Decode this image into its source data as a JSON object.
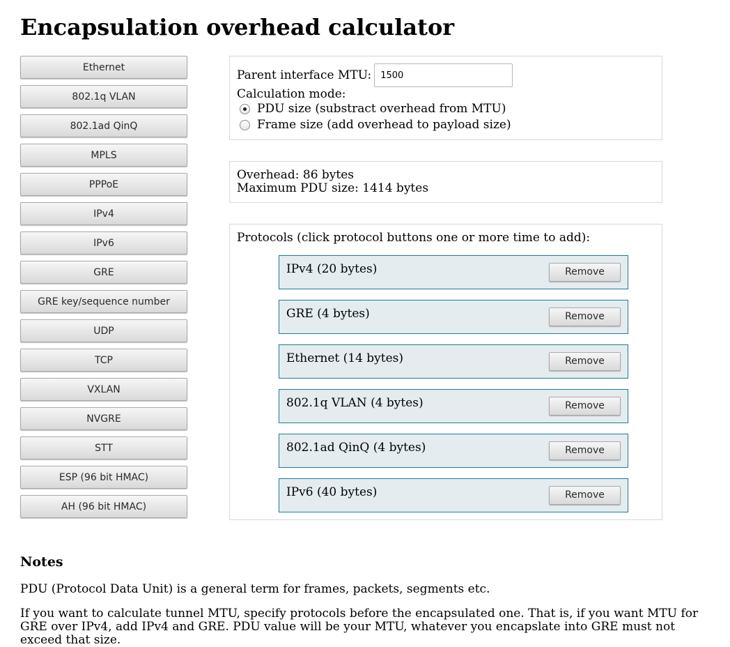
{
  "page": {
    "title": "Encapsulation overhead calculator"
  },
  "protocol_buttons": [
    "Ethernet",
    "802.1q VLAN",
    "802.1ad QinQ",
    "MPLS",
    "PPPoE",
    "IPv4",
    "IPv6",
    "GRE",
    "GRE key/sequence number",
    "UDP",
    "TCP",
    "VXLAN",
    "NVGRE",
    "STT",
    "ESP (96 bit HMAC)",
    "AH (96 bit HMAC)"
  ],
  "settings": {
    "mtu_label": "Parent interface MTU:",
    "mtu_value": "1500",
    "mode_label": "Calculation mode:",
    "mode_pdu_label": "PDU size (substract overhead from MTU)",
    "mode_frame_label": "Frame size (add overhead to payload size)",
    "selected_mode": "pdu"
  },
  "result": {
    "overhead": "Overhead: 86 bytes",
    "max_pdu": "Maximum PDU size: 1414 bytes"
  },
  "protocols": {
    "label": "Protocols (click protocol buttons one or more time to add):",
    "remove_label": "Remove",
    "added": [
      "IPv4 (20 bytes)",
      "GRE (4 bytes)",
      "Ethernet (14 bytes)",
      "802.1q VLAN (4 bytes)",
      "802.1ad QinQ (4 bytes)",
      "IPv6 (40 bytes)"
    ]
  },
  "notes": {
    "title": "Notes",
    "note1": "PDU (Protocol Data Unit) is a general term for frames, packets, segments etc.",
    "note2": "If you want to calculate tunnel MTU, specify protocols before the encapsulated one. That is, if you want MTU for GRE over IPv4, add IPv4 and GRE. PDU value will be your MTU, whatever you encapslate into GRE must not exceed that size."
  }
}
